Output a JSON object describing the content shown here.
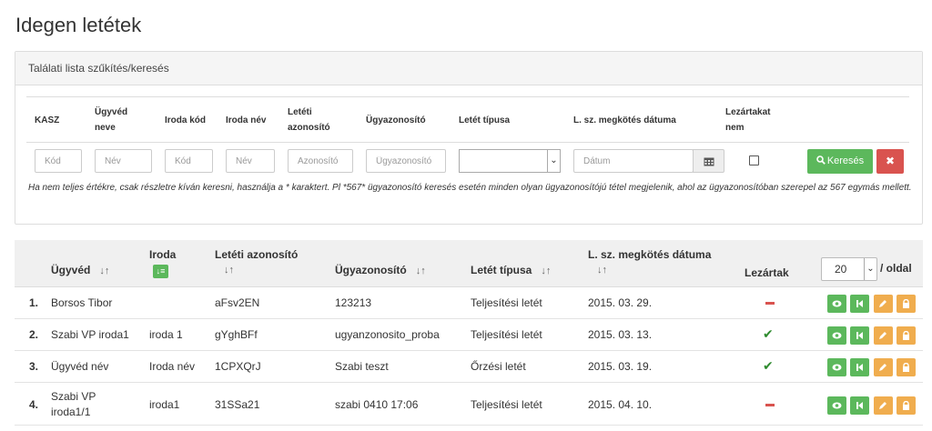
{
  "page": {
    "title": "Idegen letétek"
  },
  "filter": {
    "panel_title": "Találati lista szűkítés/keresés",
    "labels": {
      "kasz": "KASZ",
      "ugyved_neve": [
        "Ügyvéd",
        "neve"
      ],
      "iroda_kod": "Iroda kód",
      "iroda_nev": "Iroda név",
      "leteti_azonosito": [
        "Letéti",
        "azonosító"
      ],
      "ugyazonosito": "Ügyazonosító",
      "letet_tipusa": "Letét típusa",
      "megkotes_datuma": "L. sz. megkötés dátuma",
      "lezartakat_nem": [
        "Lezártakat",
        "nem"
      ]
    },
    "placeholders": {
      "kasz": "Kód",
      "ugyved_neve": "Név",
      "iroda_kod": "Kód",
      "iroda_nev": "Név",
      "leteti_azonosito": "Azonosító",
      "ugyazonosito": "Ügyazonosító",
      "datum": "Dátum"
    },
    "letet_tipusa_value": "",
    "lezartakat_nem_checked": false,
    "search_button": "Keresés",
    "clear_button": "✖",
    "hint": "Ha nem teljes értékre, csak részletre kíván keresni, használja a * karaktert. Pl *567* ügyazonosító keresés esetén minden olyan ügyazonosítójú tétel megjelenik, ahol az ügyazonosítóban szerepel az 567 egymás mellett."
  },
  "table": {
    "columns": {
      "ugyved": "Ügyvéd",
      "iroda": "Iroda",
      "leteti_azonosito": "Letéti azonosító",
      "ugyazonosito": "Ügyazonosító",
      "letet_tipusa": "Letét típusa",
      "megkotes_datuma": "L. sz. megkötés dátuma",
      "lezartak": "Lezártak"
    },
    "sort_icon": "↓↑",
    "sort_active_icon": "↓≡",
    "per_page": "20",
    "per_page_label": "/ oldal",
    "rows": [
      {
        "num": "1.",
        "ugyved": "Borsos Tibor",
        "iroda": "",
        "leteti_azonosito": "aFsv2EN",
        "ugyazonosito": "123213",
        "letet_tipusa": "Teljesítési letét",
        "datum": "2015. 03. 29.",
        "lezart": false
      },
      {
        "num": "2.",
        "ugyved": "Szabi VP iroda1",
        "iroda": "iroda 1",
        "leteti_azonosito": "gYghBFf",
        "ugyazonosito": "ugyanzonosito_proba",
        "letet_tipusa": "Teljesítési letét",
        "datum": "2015. 03. 13.",
        "lezart": true
      },
      {
        "num": "3.",
        "ugyved": "Ügyvéd név",
        "iroda": "Iroda név",
        "leteti_azonosito": "1CPXQrJ",
        "ugyazonosito": "Szabi teszt",
        "letet_tipusa": "Őrzési letét",
        "datum": "2015. 03. 19.",
        "lezart": true
      },
      {
        "num": "4.",
        "ugyved": [
          "Szabi VP",
          "iroda1/1"
        ],
        "iroda": "iroda1",
        "leteti_azonosito": "31SSa21",
        "ugyazonosito": "szabi 0410 17:06",
        "letet_tipusa": "Teljesítési letét",
        "datum": "2015. 04. 10.",
        "lezart": false
      }
    ],
    "row_actions": [
      "view-icon",
      "step-back-icon",
      "edit-icon",
      "lock-icon"
    ]
  },
  "colors": {
    "green": "#5cb85c",
    "red": "#d9534f",
    "orange": "#f0ad4e",
    "check": "#2e8b2e"
  }
}
